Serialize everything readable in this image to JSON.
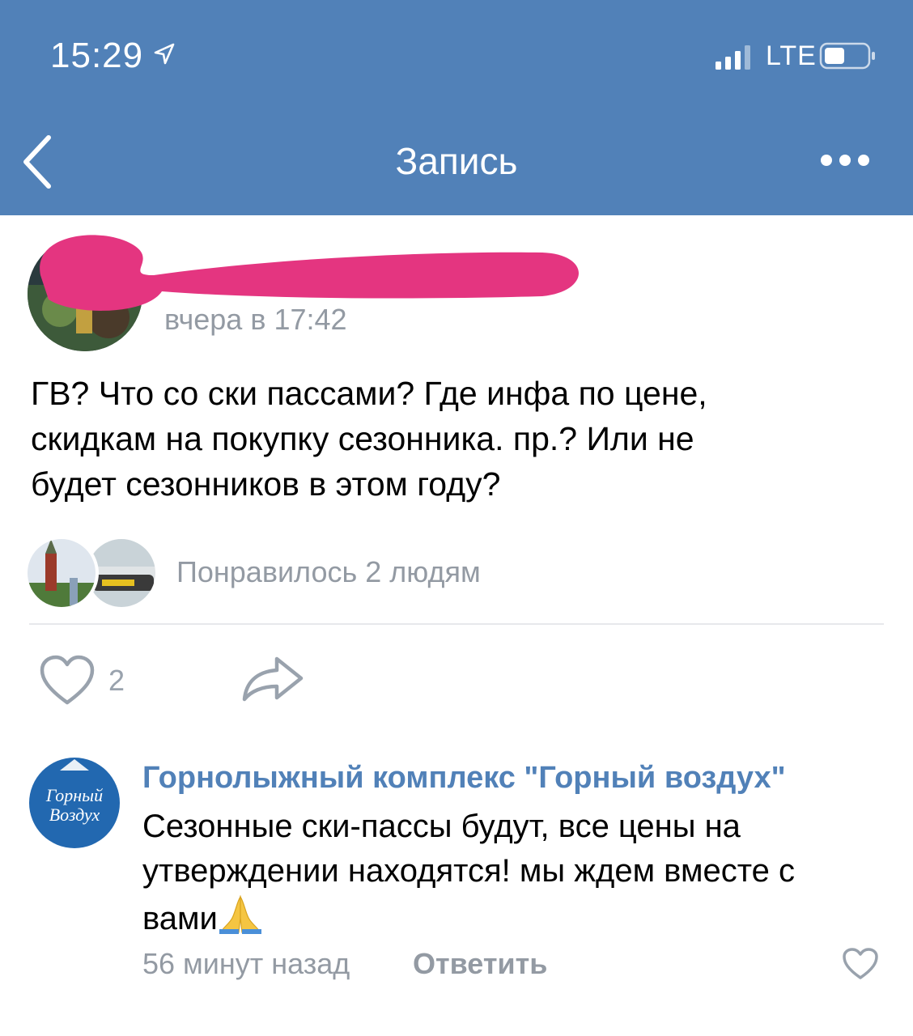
{
  "status_bar": {
    "time": "15:29",
    "network": "LTE"
  },
  "nav": {
    "title": "Запись"
  },
  "post": {
    "timestamp": "вчера в 17:42",
    "text_lines": [
      "ГВ? Что со ски пассами? Где инфа по цене,",
      "скидкам на покупку сезонника.  пр.? Или не",
      "будет сезонников в этом году?"
    ],
    "liked_by": "Понравилось 2 людям",
    "like_count": "2"
  },
  "comment": {
    "author": "Горнолыжный комплекс \"Горный воздух\"",
    "avatar_lines": [
      "Горный",
      "Воздух"
    ],
    "text_lines": [
      "Сезонные ски-пассы будут, все цены на",
      "утверждении находятся! мы ждем вместе с",
      "вами"
    ],
    "emoji": "folded-hands",
    "time": "56 минут назад",
    "reply_label": "Ответить"
  },
  "colors": {
    "header": "#5181b8",
    "link": "#5181b8",
    "secondary_text": "#939aa3",
    "redaction": "#e43580"
  }
}
